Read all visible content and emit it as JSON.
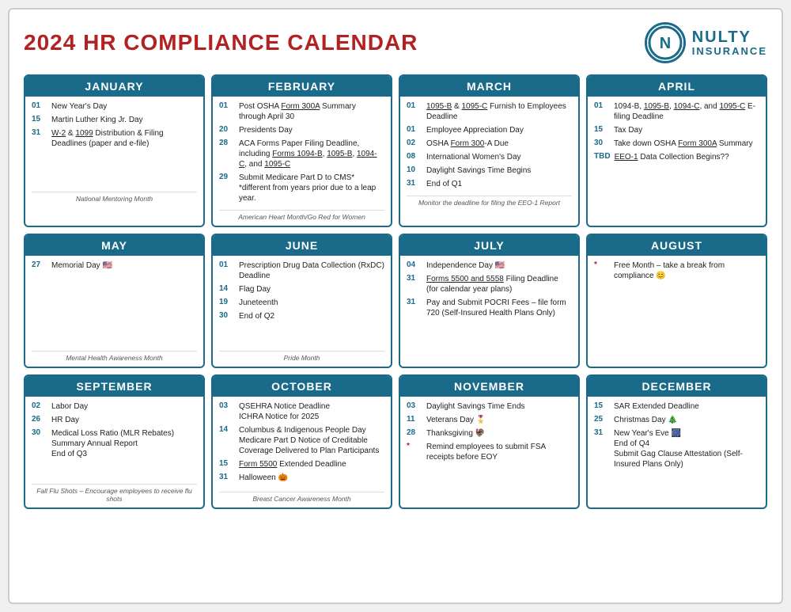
{
  "header": {
    "title": "2024 HR COMPLIANCE CALENDAR",
    "logo_letter": "N",
    "logo_name": "NULTY",
    "logo_sub": "INSURANCE"
  },
  "months": [
    {
      "name": "JANUARY",
      "events": [
        {
          "day": "01",
          "text": "New Year's Day"
        },
        {
          "day": "15",
          "text": "Martin Luther King Jr. Day"
        },
        {
          "day": "31",
          "text": "W-2 & 1099 Distribution & Filing Deadlines (paper and e-file)"
        }
      ],
      "footer": "National Mentoring Month"
    },
    {
      "name": "FEBRUARY",
      "events": [
        {
          "day": "01",
          "text": "Post OSHA Form 300A Summary through April 30"
        },
        {
          "day": "20",
          "text": "Presidents Day"
        },
        {
          "day": "28",
          "text": "ACA Forms Paper Filing Deadline, including Forms 1094-B, 1095-B, 1094-C, and 1095-C"
        },
        {
          "day": "29",
          "text": "Submit Medicare Part D to CMS*\n*different from years prior due to a leap year."
        }
      ],
      "footer": "American Heart Month/Go Red for Women"
    },
    {
      "name": "MARCH",
      "events": [
        {
          "day": "01",
          "text": "1095-B & 1095-C Furnish to Employees Deadline"
        },
        {
          "day": "01",
          "text": "Employee Appreciation Day"
        },
        {
          "day": "02",
          "text": "OSHA Form 300-A Due"
        },
        {
          "day": "08",
          "text": "International Women's Day"
        },
        {
          "day": "10",
          "text": "Daylight Savings Time Begins"
        },
        {
          "day": "31",
          "text": "End of Q1"
        }
      ],
      "footer": "Monitor the deadline for filing the EEO-1 Report"
    },
    {
      "name": "APRIL",
      "events": [
        {
          "day": "01",
          "text": "1094-B, 1095-B, 1094-C, and 1095-C E-filing Deadline"
        },
        {
          "day": "15",
          "text": "Tax Day"
        },
        {
          "day": "30",
          "text": "Take down OSHA Form 300A Summary"
        },
        {
          "day": "TBD",
          "text": "EEO-1 Data Collection Begins??"
        }
      ],
      "footer": ""
    },
    {
      "name": "MAY",
      "events": [
        {
          "day": "27",
          "text": "Memorial Day 🇺🇸"
        }
      ],
      "footer": "Mental Health Awareness Month"
    },
    {
      "name": "JUNE",
      "events": [
        {
          "day": "01",
          "text": "Prescription Drug Data Collection (RxDC) Deadline"
        },
        {
          "day": "14",
          "text": "Flag Day"
        },
        {
          "day": "19",
          "text": "Juneteenth"
        },
        {
          "day": "30",
          "text": "End of Q2"
        }
      ],
      "footer": "Pride Month"
    },
    {
      "name": "JULY",
      "events": [
        {
          "day": "04",
          "text": "Independence Day 🇺🇸"
        },
        {
          "day": "31",
          "text": "Forms 5500 and 5558 Filing Deadline (for calendar year plans)"
        },
        {
          "day": "31",
          "text": "Pay and Submit POCRI Fees – file form 720 (Self-Insured Health Plans Only)"
        }
      ],
      "footer": ""
    },
    {
      "name": "AUGUST",
      "events": [
        {
          "day": "*",
          "text": "Free Month – take a break from compliance 😊",
          "star": true
        }
      ],
      "footer": ""
    },
    {
      "name": "SEPTEMBER",
      "events": [
        {
          "day": "02",
          "text": "Labor Day"
        },
        {
          "day": "26",
          "text": "HR Day"
        },
        {
          "day": "30",
          "text": "Medical Loss Ratio (MLR Rebates) Summary Annual Report\nEnd of Q3"
        }
      ],
      "footer": "Fall Flu Shots – Encourage employees to receive flu shots"
    },
    {
      "name": "OCTOBER",
      "events": [
        {
          "day": "03",
          "text": "QSEHRA Notice Deadline\nICHRA Notice for 2025"
        },
        {
          "day": "14",
          "text": "Columbus & Indigenous People Day\nMedicare Part D Notice of Creditable Coverage Delivered to Plan Participants"
        },
        {
          "day": "15",
          "text": "Form 5500 Extended Deadline"
        },
        {
          "day": "31",
          "text": "Halloween 🎃"
        }
      ],
      "footer": "Breast Cancer Awareness Month"
    },
    {
      "name": "NOVEMBER",
      "events": [
        {
          "day": "03",
          "text": "Daylight Savings Time Ends"
        },
        {
          "day": "11",
          "text": "Veterans Day 🎖️"
        },
        {
          "day": "28",
          "text": "Thanksgiving 🦃"
        },
        {
          "day": "*",
          "text": "Remind employees to submit FSA receipts before EOY",
          "star": true
        }
      ],
      "footer": ""
    },
    {
      "name": "DECEMBER",
      "events": [
        {
          "day": "15",
          "text": "SAR Extended Deadline"
        },
        {
          "day": "25",
          "text": "Christmas Day 🎄"
        },
        {
          "day": "31",
          "text": "New Year's Eve 🎆\nEnd of Q4\nSubmit Gag Clause Attestation (Self-Insured Plans Only)"
        }
      ],
      "footer": ""
    }
  ]
}
